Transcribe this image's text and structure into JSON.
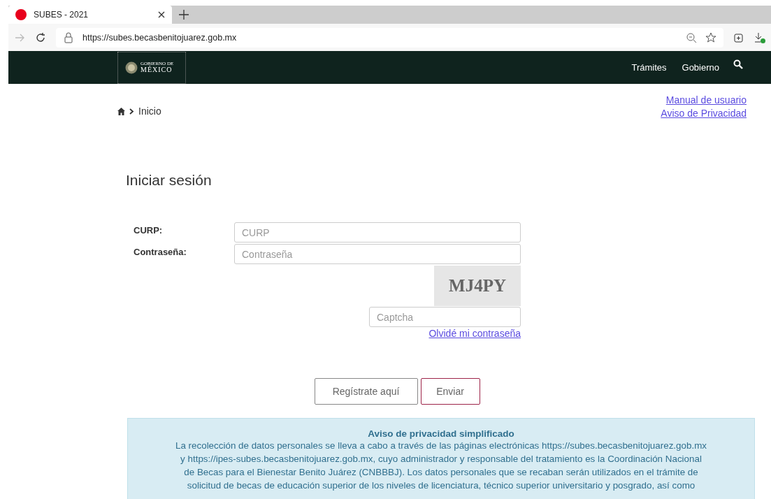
{
  "browser": {
    "tab_title": "SUBES - 2021",
    "url": "https://subes.becasbenitojuarez.gob.mx"
  },
  "header": {
    "logo_top": "GOBIERNO DE",
    "logo_bottom": "MÉXICO",
    "nav": [
      "Trámites",
      "Gobierno"
    ]
  },
  "breadcrumb": "Inicio",
  "links": [
    "Manual de usuario",
    "Aviso de Privacidad"
  ],
  "login": {
    "title": "Iniciar sesión",
    "curp_label": "CURP:",
    "curp_placeholder": "CURP",
    "password_label": "Contraseña:",
    "password_placeholder": "Contraseña",
    "captcha_image_text": "MJ4PY",
    "captcha_placeholder": "Captcha",
    "forgot_link": "Olvidé mi contraseña",
    "register_button": "Regístrate aquí",
    "submit_button": "Enviar"
  },
  "privacy": {
    "title": "Aviso de privacidad simplificado",
    "lines": [
      "La recolección de datos personales se lleva a cabo a través de las páginas electrónicas https://subes.becasbenitojuarez.gob.mx",
      "y https://ipes-subes.becasbenitojuarez.gob.mx, cuyo administrador y responsable del tratamiento es la Coordinación Nacional",
      "de Becas para el Bienestar Benito Juárez (CNBBBJ). Los datos personales que se recaban serán utilizados en el trámite de",
      "solicitud de becas de educación superior de los niveles de licenciatura, técnico superior universitario y posgrado, así como"
    ]
  }
}
